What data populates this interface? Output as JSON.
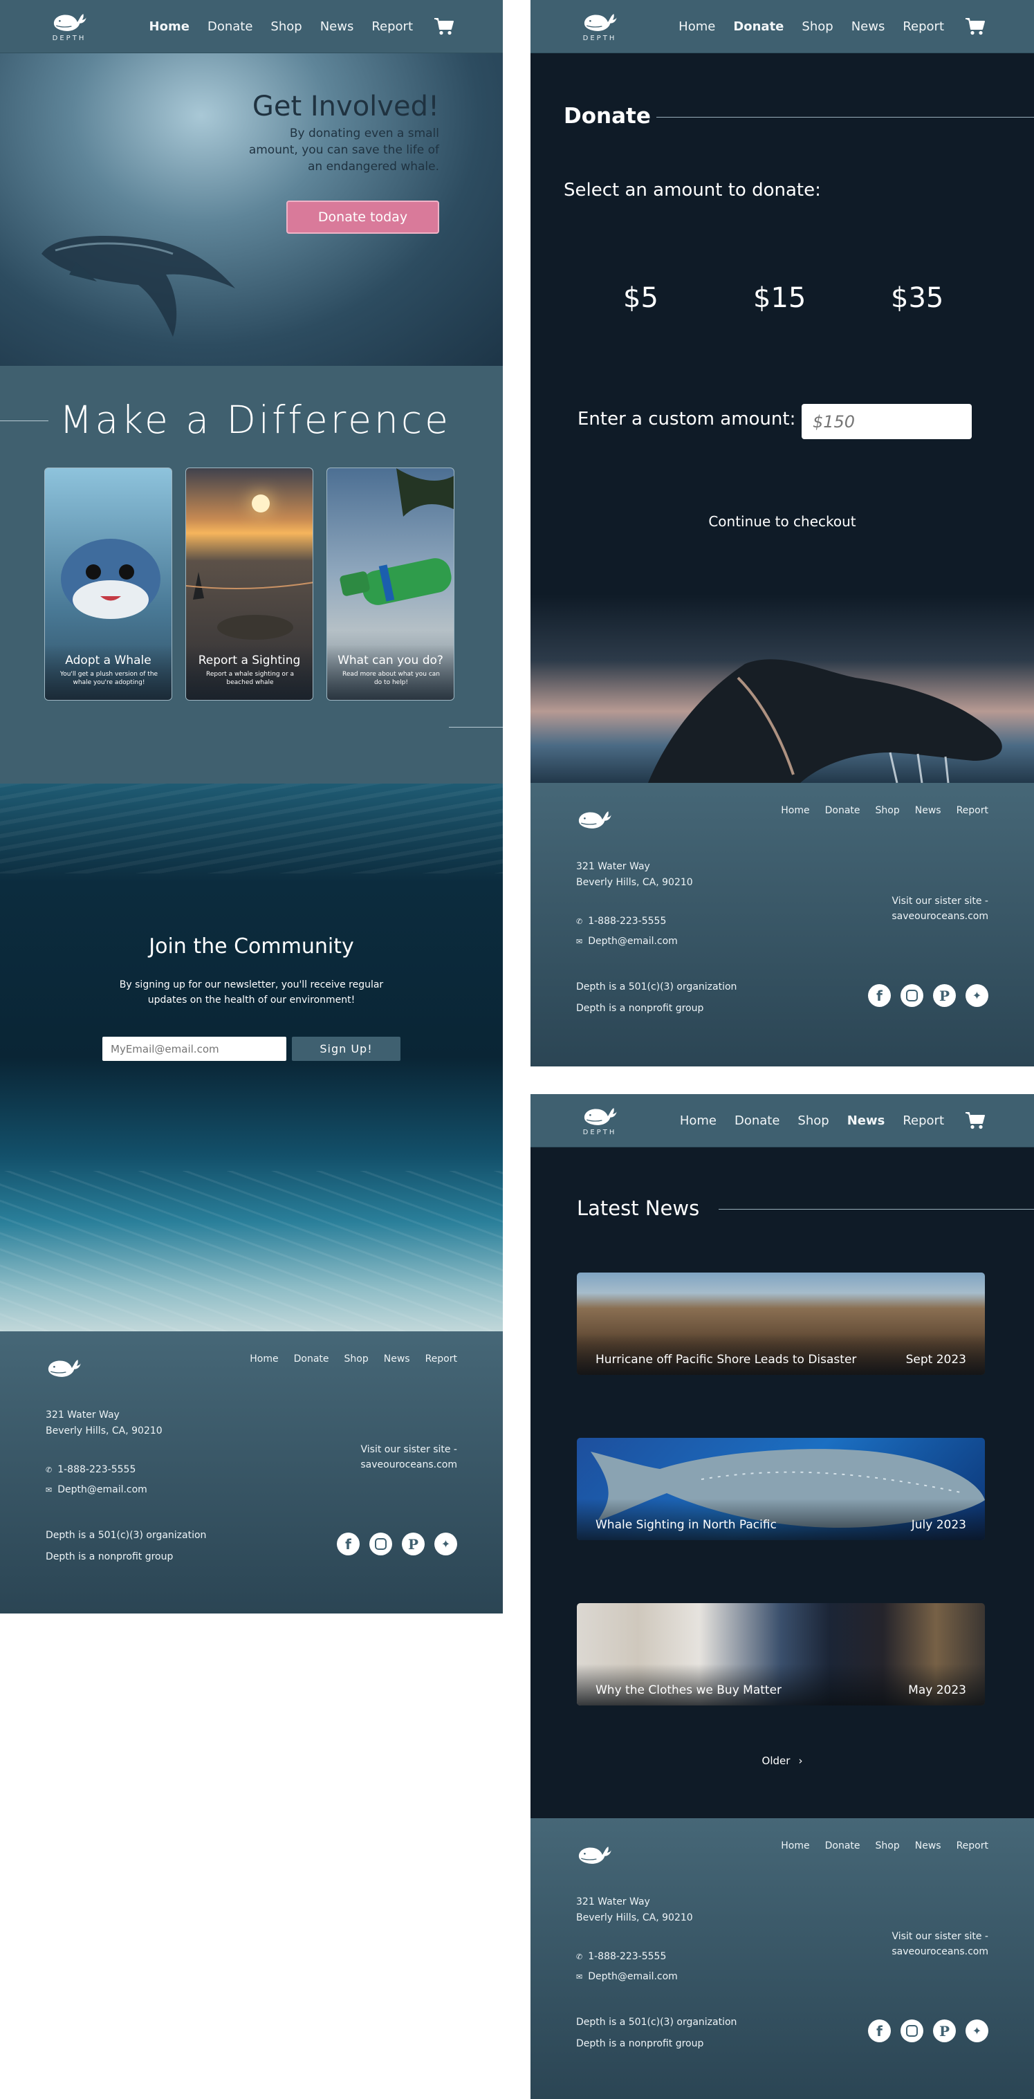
{
  "brand": {
    "name": "DEPTH"
  },
  "nav": {
    "home": "Home",
    "donate": "Donate",
    "shop": "Shop",
    "news": "News",
    "report": "Report"
  },
  "home": {
    "hero": {
      "title": "Get Involved!",
      "text": "By donating even a small amount, you can save the life of an endangered whale.",
      "button": "Donate today"
    },
    "difference": {
      "title": "Make a Difference",
      "cards": [
        {
          "title": "Adopt a Whale",
          "text": "You'll get a plush version of the whale you're adopting!"
        },
        {
          "title": "Report a Sighting",
          "text": "Report a whale sighting or a beached whale"
        },
        {
          "title": "What can you do?",
          "text": "Read more about what you can do to help!"
        }
      ]
    },
    "community": {
      "title": "Join the Community",
      "text": "By signing up for our newsletter, you'll receive regular updates on the health of our environment!",
      "email_placeholder": "MyEmail@email.com",
      "button": "Sign Up!"
    }
  },
  "donate": {
    "title": "Donate",
    "select_label": "Select an amount to donate:",
    "amounts": [
      "$5",
      "$15",
      "$35"
    ],
    "custom_label": "Enter a custom amount:",
    "custom_placeholder": "$150",
    "checkout": "Continue to checkout"
  },
  "news": {
    "title": "Latest News",
    "items": [
      {
        "headline": "Hurricane off Pacific Shore Leads to Disaster",
        "date": "Sept 2023"
      },
      {
        "headline": "Whale Sighting in North Pacific",
        "date": "July 2023"
      },
      {
        "headline": "Why the Clothes we Buy Matter",
        "date": "May 2023"
      }
    ],
    "older": "Older"
  },
  "footer": {
    "links": [
      "Home",
      "Donate",
      "Shop",
      "News",
      "Report"
    ],
    "address_line1": "321 Water Way",
    "address_line2": "Beverly Hills, CA, 90210",
    "phone": "1-888-223-5555",
    "email": "Depth@email.com",
    "sister_line1": "Visit our sister site -",
    "sister_line2": "saveouroceans.com",
    "org_line1": "Depth is a 501(c)(3) organization",
    "org_line2": "Depth is a nonprofit group",
    "social_icons": [
      "facebook-icon",
      "instagram-icon",
      "pinterest-icon",
      "twitter-icon"
    ]
  },
  "colors": {
    "nav": "#3f6070",
    "slate": "#40606f",
    "navy": "#0f1b27",
    "pink": "#d97a9a",
    "sign_up": "#3f6070"
  }
}
